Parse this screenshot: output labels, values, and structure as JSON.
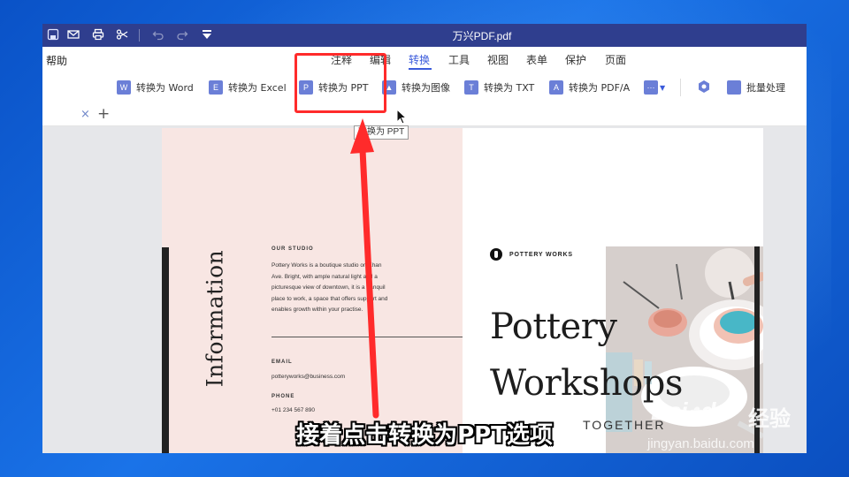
{
  "window": {
    "title": "万兴PDF.pdf"
  },
  "menu": {
    "help": "帮助",
    "tabs": [
      "注释",
      "编辑",
      "转换",
      "工具",
      "视图",
      "表单",
      "保护",
      "页面"
    ],
    "active_tab": "转换"
  },
  "ribbon": {
    "to_word": "转换为 Word",
    "to_excel": "转换为 Excel",
    "to_ppt": "转换为 PPT",
    "to_image": "转换为图像",
    "to_txt": "转换为 TXT",
    "to_pdfa": "转换为 PDF/A",
    "batch": "批量处理",
    "icons": {
      "word": "W",
      "excel": "E",
      "ppt": "P",
      "txt": "T",
      "pdfa": "A"
    }
  },
  "tooltip": "转换为 PPT",
  "tabstrip": {
    "close": "×",
    "add": "+"
  },
  "document": {
    "information": "Information",
    "our_studio_head": "OUR STUDIO",
    "studio_lines": [
      "Pottery Works is a boutique studio on Khan",
      "Ave. Bright, with ample natural light and a",
      "picturesque view of downtown, it is a tranquil",
      "place to work, a space that offers support and",
      "enables growth within your practise."
    ],
    "email_head": "EMAIL",
    "email": "potteryworks@business.com",
    "phone_head": "PHONE",
    "phone": "+01 234 567 890",
    "brand": "POTTERY WORKS",
    "headline_1": "Pottery",
    "headline_2": "Workshops",
    "together": "TOGETHER"
  },
  "caption": "接着点击转换为PPT选项",
  "watermark": {
    "logo": "Bai",
    "logo_tail": "du",
    "cn": "经验",
    "url": "jingyan.baidu.com"
  },
  "colors": {
    "titlebar": "#2f3e8e",
    "accent": "#3b5bdb",
    "highlight_box": "#ff2b2b"
  }
}
